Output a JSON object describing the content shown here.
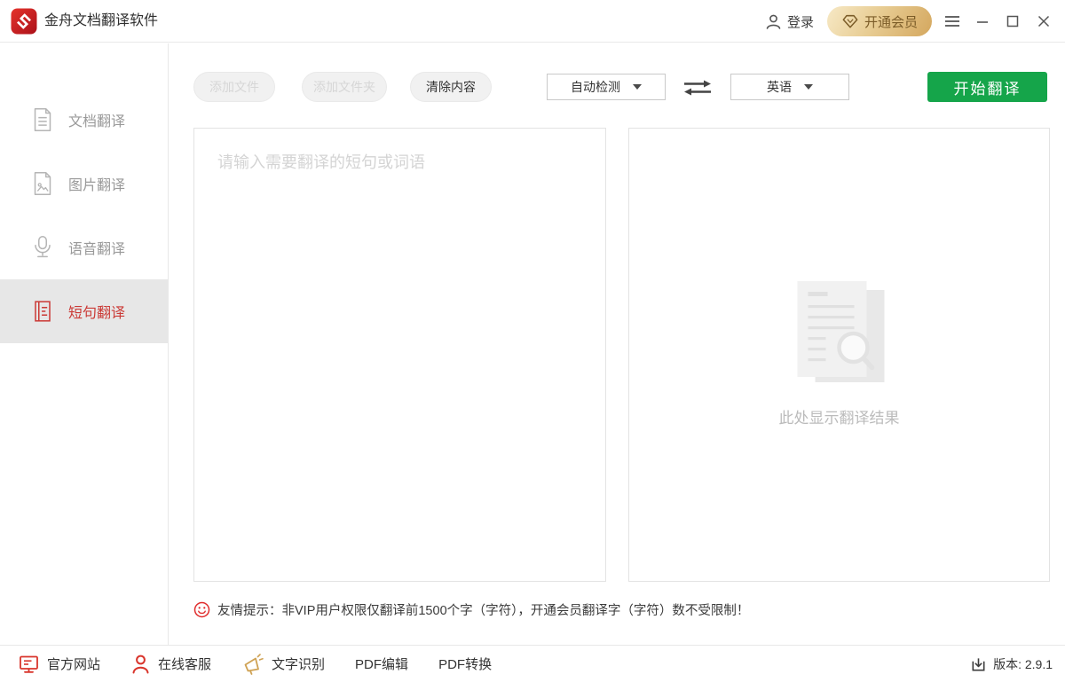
{
  "titlebar": {
    "app_title": "金舟文档翻译软件",
    "login_label": "登录",
    "vip_label": "开通会员"
  },
  "sidebar": {
    "items": [
      {
        "label": "文档翻译",
        "active": false
      },
      {
        "label": "图片翻译",
        "active": false
      },
      {
        "label": "语音翻译",
        "active": false
      },
      {
        "label": "短句翻译",
        "active": true
      }
    ]
  },
  "toolbar": {
    "add_file_label": "添加文件",
    "add_folder_label": "添加文件夹",
    "clear_label": "清除内容",
    "source_language": "自动检测",
    "target_language": "英语",
    "translate_label": "开始翻译"
  },
  "main": {
    "input_placeholder": "请输入需要翻译的短句或词语",
    "result_placeholder": "此处显示翻译结果",
    "tip_text": "友情提示：非VIP用户权限仅翻译前1500个字（字符），开通会员翻译字（字符）数不受限制！"
  },
  "footer": {
    "links": [
      "官方网站",
      "在线客服",
      "文字识别",
      "PDF编辑",
      "PDF转换"
    ],
    "version_text": "版本: 2.9.1"
  },
  "colors": {
    "brand_red": "#cf1f26",
    "accent_green": "#15a54a",
    "active_item_red": "#cb3a36",
    "vip_gold_start": "#f7e9c6",
    "vip_gold_end": "#d4a75e",
    "vip_text": "#7b5c28",
    "disabled_text": "#d6d6d6",
    "placeholder_gray": "#d4d4d4"
  }
}
